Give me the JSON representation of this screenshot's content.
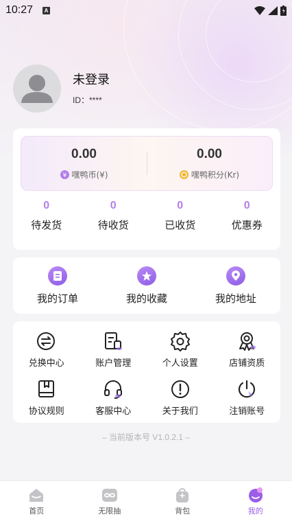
{
  "status_bar": {
    "time": "10:27",
    "badge": "A"
  },
  "profile": {
    "name": "未登录",
    "id_label": "ID：****"
  },
  "balance": {
    "coin_value": "0.00",
    "coin_label": "嘿鸭币(¥)",
    "points_value": "0.00",
    "points_label": "嘿鸭积分(Kr)"
  },
  "order_stats": [
    {
      "count": "0",
      "label": "待发货"
    },
    {
      "count": "0",
      "label": "待收货"
    },
    {
      "count": "0",
      "label": "已收货"
    },
    {
      "count": "0",
      "label": "优惠券"
    }
  ],
  "quick_links": [
    {
      "label": "我的订单",
      "icon": "order-icon"
    },
    {
      "label": "我的收藏",
      "icon": "star-icon"
    },
    {
      "label": "我的地址",
      "icon": "location-icon"
    }
  ],
  "services": [
    {
      "label": "兑换中心",
      "icon": "exchange-icon"
    },
    {
      "label": "账户管理",
      "icon": "account-icon"
    },
    {
      "label": "个人设置",
      "icon": "gear-icon"
    },
    {
      "label": "店铺资质",
      "icon": "award-icon"
    },
    {
      "label": "协议规则",
      "icon": "rules-icon"
    },
    {
      "label": "客服中心",
      "icon": "headset-icon"
    },
    {
      "label": "关于我们",
      "icon": "info-icon"
    },
    {
      "label": "注销账号",
      "icon": "power-icon"
    }
  ],
  "version": "– 当前版本号 V1.0.2.1 –",
  "tabs": [
    {
      "label": "首页",
      "icon": "home-icon",
      "active": false
    },
    {
      "label": "无限抽",
      "icon": "infinity-icon",
      "active": false
    },
    {
      "label": "背包",
      "icon": "bag-icon",
      "active": false
    },
    {
      "label": "我的",
      "icon": "profile-icon",
      "active": true
    }
  ],
  "colors": {
    "accent": "#9b5ee8",
    "stat_number": "#b57ee8",
    "background": "#f4f4f6"
  }
}
